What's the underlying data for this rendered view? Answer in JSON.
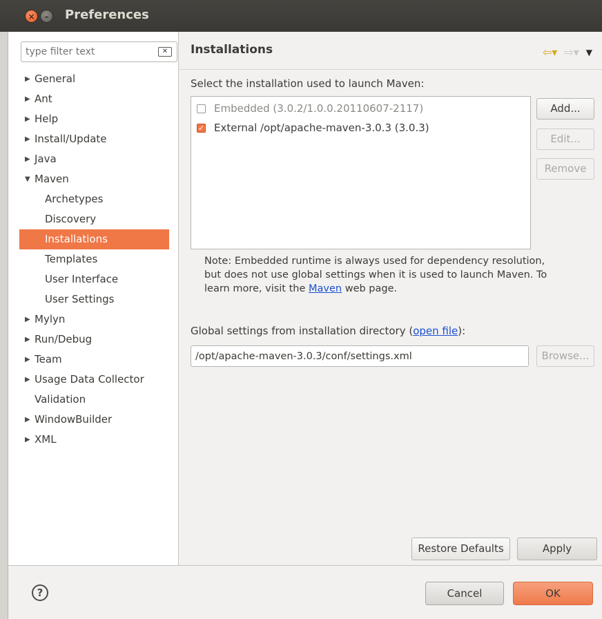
{
  "window": {
    "title": "Preferences"
  },
  "filter": {
    "placeholder": "type filter text"
  },
  "tree": [
    {
      "label": "General",
      "expandable": true,
      "expanded": false,
      "level": 0
    },
    {
      "label": "Ant",
      "expandable": true,
      "expanded": false,
      "level": 0
    },
    {
      "label": "Help",
      "expandable": true,
      "expanded": false,
      "level": 0
    },
    {
      "label": "Install/Update",
      "expandable": true,
      "expanded": false,
      "level": 0
    },
    {
      "label": "Java",
      "expandable": true,
      "expanded": false,
      "level": 0
    },
    {
      "label": "Maven",
      "expandable": true,
      "expanded": true,
      "level": 0
    },
    {
      "label": "Archetypes",
      "level": 1
    },
    {
      "label": "Discovery",
      "level": 1
    },
    {
      "label": "Installations",
      "level": 1,
      "selected": true
    },
    {
      "label": "Templates",
      "level": 1
    },
    {
      "label": "User Interface",
      "level": 1
    },
    {
      "label": "User Settings",
      "level": 1
    },
    {
      "label": "Mylyn",
      "expandable": true,
      "expanded": false,
      "level": 0
    },
    {
      "label": "Run/Debug",
      "expandable": true,
      "expanded": false,
      "level": 0
    },
    {
      "label": "Team",
      "expandable": true,
      "expanded": false,
      "level": 0
    },
    {
      "label": "Usage Data Collector",
      "expandable": true,
      "expanded": false,
      "level": 0
    },
    {
      "label": "Validation",
      "expandable": false,
      "level": 0
    },
    {
      "label": "WindowBuilder",
      "expandable": true,
      "expanded": false,
      "level": 0
    },
    {
      "label": "XML",
      "expandable": true,
      "expanded": false,
      "level": 0
    }
  ],
  "page": {
    "title": "Installations",
    "select_label": "Select the installation used to launch Maven:",
    "installations": [
      {
        "label": "Embedded (3.0.2/1.0.0.20110607-2117)",
        "checked": false,
        "enabled": false
      },
      {
        "label": "External /opt/apache-maven-3.0.3 (3.0.3)",
        "checked": true,
        "enabled": true
      }
    ],
    "buttons": {
      "add": "Add...",
      "edit": "Edit...",
      "remove": "Remove",
      "browse": "Browse..."
    },
    "note_prefix": "Note: Embedded runtime is always used for dependency resolution, but does not use global settings when it is used to launch Maven. To learn more, visit the ",
    "note_link": "Maven",
    "note_suffix": " web page.",
    "global_label_prefix": "Global settings from installation directory (",
    "global_label_link": "open file",
    "global_label_suffix": "):",
    "global_settings_value": "/opt/apache-maven-3.0.3/conf/settings.xml",
    "restore_defaults": "Restore Defaults",
    "apply": "Apply"
  },
  "footer": {
    "help_glyph": "?",
    "cancel": "Cancel",
    "ok": "OK"
  },
  "colors": {
    "accent": "#f07746",
    "titlebar": "#3c3b37",
    "link": "#1a4fd0"
  }
}
